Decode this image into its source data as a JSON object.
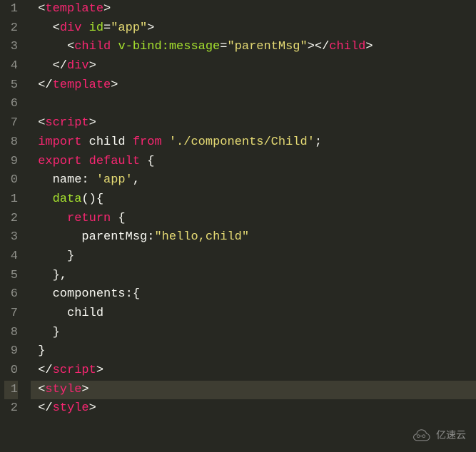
{
  "lines": [
    {
      "n": "1",
      "segs": [
        {
          "c": "tag-bracket",
          "t": "<"
        },
        {
          "c": "tag-name",
          "t": "template"
        },
        {
          "c": "tag-bracket",
          "t": ">"
        }
      ],
      "indent": 1
    },
    {
      "n": "2",
      "segs": [
        {
          "c": "tag-bracket",
          "t": "<"
        },
        {
          "c": "tag-name",
          "t": "div"
        },
        {
          "c": "punct",
          "t": " "
        },
        {
          "c": "attr-name",
          "t": "id"
        },
        {
          "c": "attr-op",
          "t": "="
        },
        {
          "c": "string",
          "t": "\"app\""
        },
        {
          "c": "tag-bracket",
          "t": ">"
        }
      ],
      "indent": 3
    },
    {
      "n": "3",
      "segs": [
        {
          "c": "tag-bracket",
          "t": "<"
        },
        {
          "c": "tag-name",
          "t": "child"
        },
        {
          "c": "punct",
          "t": " "
        },
        {
          "c": "attr-name",
          "t": "v-bind:message"
        },
        {
          "c": "attr-op",
          "t": "="
        },
        {
          "c": "string",
          "t": "\"parentMsg\""
        },
        {
          "c": "tag-bracket",
          "t": "></"
        },
        {
          "c": "tag-name",
          "t": "child"
        },
        {
          "c": "tag-bracket",
          "t": ">"
        }
      ],
      "indent": 5
    },
    {
      "n": "4",
      "segs": [
        {
          "c": "tag-bracket",
          "t": "</"
        },
        {
          "c": "tag-name",
          "t": "div"
        },
        {
          "c": "tag-bracket",
          "t": ">"
        }
      ],
      "indent": 3
    },
    {
      "n": "5",
      "segs": [
        {
          "c": "tag-bracket",
          "t": "</"
        },
        {
          "c": "tag-name",
          "t": "template"
        },
        {
          "c": "tag-bracket",
          "t": ">"
        }
      ],
      "indent": 1
    },
    {
      "n": "6",
      "segs": [],
      "indent": 0
    },
    {
      "n": "7",
      "segs": [
        {
          "c": "tag-bracket",
          "t": "<"
        },
        {
          "c": "tag-name",
          "t": "script"
        },
        {
          "c": "tag-bracket",
          "t": ">"
        }
      ],
      "indent": 1
    },
    {
      "n": "8",
      "segs": [
        {
          "c": "keyword",
          "t": "import"
        },
        {
          "c": "varname",
          "t": " child "
        },
        {
          "c": "keyword",
          "t": "from"
        },
        {
          "c": "punct",
          "t": " "
        },
        {
          "c": "string",
          "t": "'./components/Child'"
        },
        {
          "c": "punct",
          "t": ";"
        }
      ],
      "indent": 1
    },
    {
      "n": "9",
      "segs": [
        {
          "c": "keyword",
          "t": "export"
        },
        {
          "c": "punct",
          "t": " "
        },
        {
          "c": "keyword",
          "t": "default"
        },
        {
          "c": "punct",
          "t": " {"
        }
      ],
      "indent": 1
    },
    {
      "n": "0",
      "segs": [
        {
          "c": "varname",
          "t": "name: "
        },
        {
          "c": "string",
          "t": "'app'"
        },
        {
          "c": "punct",
          "t": ","
        }
      ],
      "indent": 3
    },
    {
      "n": "1",
      "segs": [
        {
          "c": "funcname",
          "t": "data"
        },
        {
          "c": "punct",
          "t": "(){"
        }
      ],
      "indent": 3
    },
    {
      "n": "2",
      "segs": [
        {
          "c": "keyword",
          "t": "return"
        },
        {
          "c": "punct",
          "t": " {"
        }
      ],
      "indent": 5
    },
    {
      "n": "3",
      "segs": [
        {
          "c": "varname",
          "t": "parentMsg:"
        },
        {
          "c": "string",
          "t": "\"hello,child\""
        }
      ],
      "indent": 7
    },
    {
      "n": "4",
      "segs": [
        {
          "c": "punct",
          "t": "}"
        }
      ],
      "indent": 5
    },
    {
      "n": "5",
      "segs": [
        {
          "c": "punct",
          "t": "},"
        }
      ],
      "indent": 3
    },
    {
      "n": "6",
      "segs": [
        {
          "c": "varname",
          "t": "components:{"
        }
      ],
      "indent": 3
    },
    {
      "n": "7",
      "segs": [
        {
          "c": "varname",
          "t": "child"
        }
      ],
      "indent": 5
    },
    {
      "n": "8",
      "segs": [
        {
          "c": "punct",
          "t": "}"
        }
      ],
      "indent": 3
    },
    {
      "n": "9",
      "segs": [
        {
          "c": "punct",
          "t": "}"
        }
      ],
      "indent": 1
    },
    {
      "n": "0",
      "segs": [
        {
          "c": "tag-bracket",
          "t": "</"
        },
        {
          "c": "tag-name",
          "t": "script"
        },
        {
          "c": "tag-bracket",
          "t": ">"
        }
      ],
      "indent": 1
    },
    {
      "n": "1",
      "segs": [
        {
          "c": "tag-bracket",
          "t": "<"
        },
        {
          "c": "tag-name",
          "t": "style"
        },
        {
          "c": "tag-bracket",
          "t": ">"
        }
      ],
      "indent": 1,
      "hl": true
    },
    {
      "n": "2",
      "segs": [
        {
          "c": "tag-bracket",
          "t": "</"
        },
        {
          "c": "tag-name",
          "t": "style"
        },
        {
          "c": "tag-bracket",
          "t": ">"
        }
      ],
      "indent": 1
    }
  ],
  "watermark": "亿速云"
}
